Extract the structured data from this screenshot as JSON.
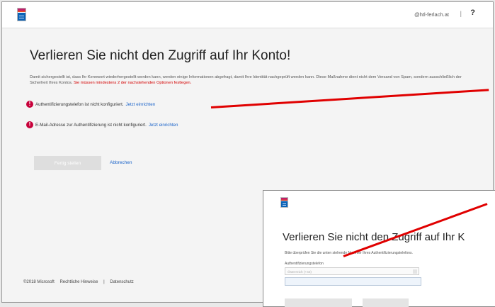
{
  "header": {
    "account": "@htl-ferlach.at",
    "separator": "|",
    "help": "?"
  },
  "main": {
    "title": "Verlieren Sie nicht den Zugriff auf Ihr Konto!",
    "description": "Damit sichergestellt ist, dass Ihr Kennwort wiederhergestellt werden kann, werden einige Informationen abgefragt, damit Ihre Identität nachgeprüft werden kann. Diese Maßnahme dient nicht dem Versand von Spam, sondern ausschließlich der Sicherheit Ihres Kontos.",
    "warning": "Sie müssen mindestens 2 der nachstehenden Optionen festlegen.",
    "options": [
      {
        "text": "Authentifizierungstelefon ist nicht konfiguriert.",
        "link": "Jetzt einrichten"
      },
      {
        "text": "E-Mail-Adresse zur Authentifizierung ist nicht konfiguriert.",
        "link": "Jetzt einrichten"
      }
    ],
    "finish_label": "Fertig stellen",
    "cancel_label": "Abbrechen"
  },
  "footer": {
    "copyright": "©2018 Microsoft",
    "legal": "Rechtliche Hinweise",
    "separator": "|",
    "privacy": "Datenschutz"
  },
  "inset": {
    "title": "Verlieren Sie nicht den Zugriff auf Ihr K",
    "info": "Bitte überprüfen Sie die unten stehende Nummer Ihres Authentifizierungstelefons.",
    "field_label": "Authentifizierungstelefon",
    "country": "Österreich (+43)"
  },
  "colors": {
    "warning": "#d40000",
    "link": "#1a63c9",
    "alert_icon": "#c7003a",
    "arrow": "#e00000"
  }
}
